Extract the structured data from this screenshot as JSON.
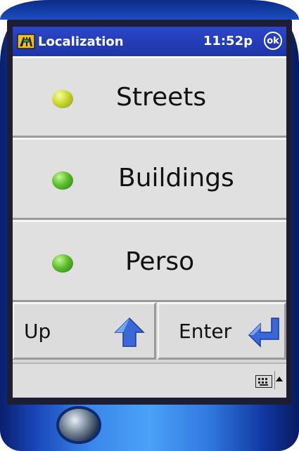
{
  "titlebar": {
    "title": "Localization",
    "time": "11:52p",
    "ok_label": "ok"
  },
  "rows": [
    {
      "label": "Streets",
      "bullet_color": "#c9d830"
    },
    {
      "label": "Buildings",
      "bullet_color": "#5cc02a"
    },
    {
      "label": "Perso",
      "bullet_color": "#5cc02a"
    }
  ],
  "buttons": {
    "up_label": "Up",
    "enter_label": "Enter"
  },
  "icons": {
    "app": "map-sign-icon",
    "up": "up-arrow-icon",
    "enter": "enter-arrow-icon",
    "keyboard": "keyboard-icon"
  },
  "colors": {
    "titlebar": "#2a47c8",
    "arrow": "#3a68d8",
    "device": "#2f78e0"
  }
}
